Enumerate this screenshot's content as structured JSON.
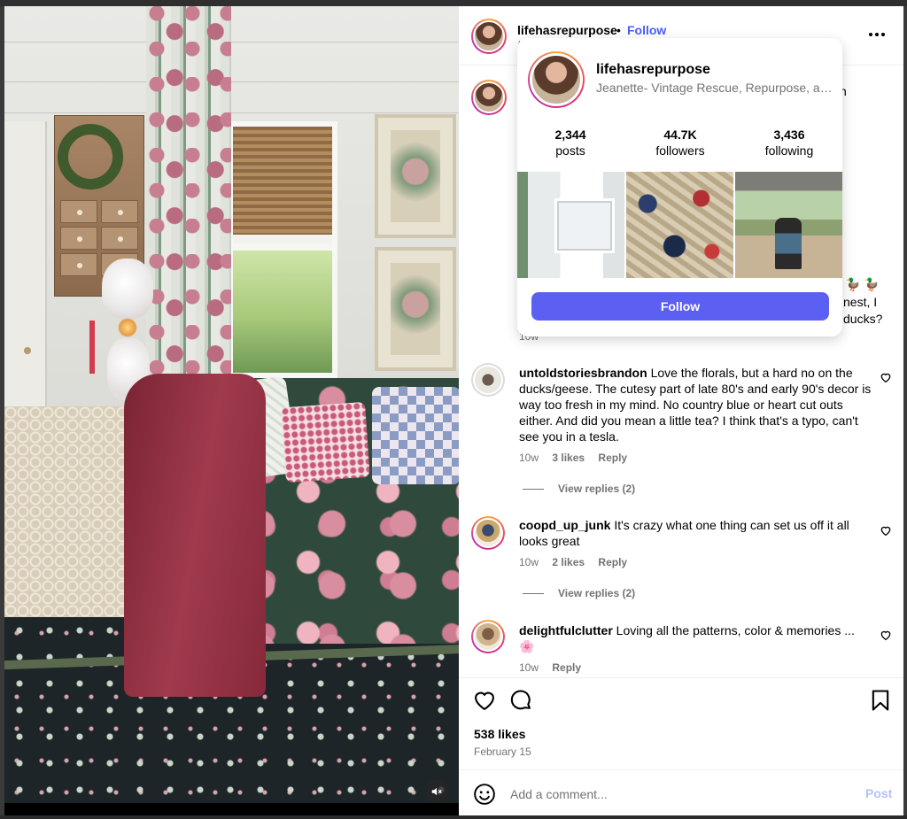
{
  "post": {
    "username": "lifehasrepurpose",
    "separator": "•",
    "follow_label": "Follow",
    "more_icon": "more-horizontal-icon",
    "likes": "538 likes",
    "date": "February 15"
  },
  "caption": {
    "tail_line1": "n",
    "ducks": "🦆 🦆",
    "tail_line2": "nest, I",
    "tail_line3": "ducks?",
    "time": "10w"
  },
  "comments": [
    {
      "username": "untoldstoriesbrandon",
      "text": "Love the florals, but a hard no on the ducks/geese. The cutesy part of late 80's and early 90's decor is way too fresh in my mind. No country blue or heart cut outs either. And did you mean a little tea? I think that's a typo, can't see you in a tesla.",
      "time": "10w",
      "likes": "3 likes",
      "reply": "Reply",
      "view_replies": "View replies (2)"
    },
    {
      "username": "coopd_up_junk",
      "text": "It's crazy what one thing can set us off it all looks great",
      "time": "10w",
      "likes": "2 likes",
      "reply": "Reply",
      "view_replies": "View replies (2)"
    },
    {
      "username": "delightfulclutter",
      "text": "Loving all the patterns, color & memories ...",
      "emoji": "🌸",
      "time": "10w",
      "reply": "Reply"
    }
  ],
  "composer": {
    "placeholder": "Add a comment...",
    "post_label": "Post"
  },
  "hover_card": {
    "username": "lifehasrepurpose",
    "bio": "Jeanette- Vintage Rescue, Repurpose, and Restyle",
    "stats": [
      {
        "value": "2,344",
        "label": "posts"
      },
      {
        "value": "44.7K",
        "label": "followers"
      },
      {
        "value": "3,436",
        "label": "following"
      }
    ],
    "follow_label": "Follow"
  },
  "colors": {
    "link_blue": "#4a5df9",
    "follow_button": "#5b5ff2",
    "post_disabled": "#b3c1f8",
    "muted_text": "#737373"
  }
}
